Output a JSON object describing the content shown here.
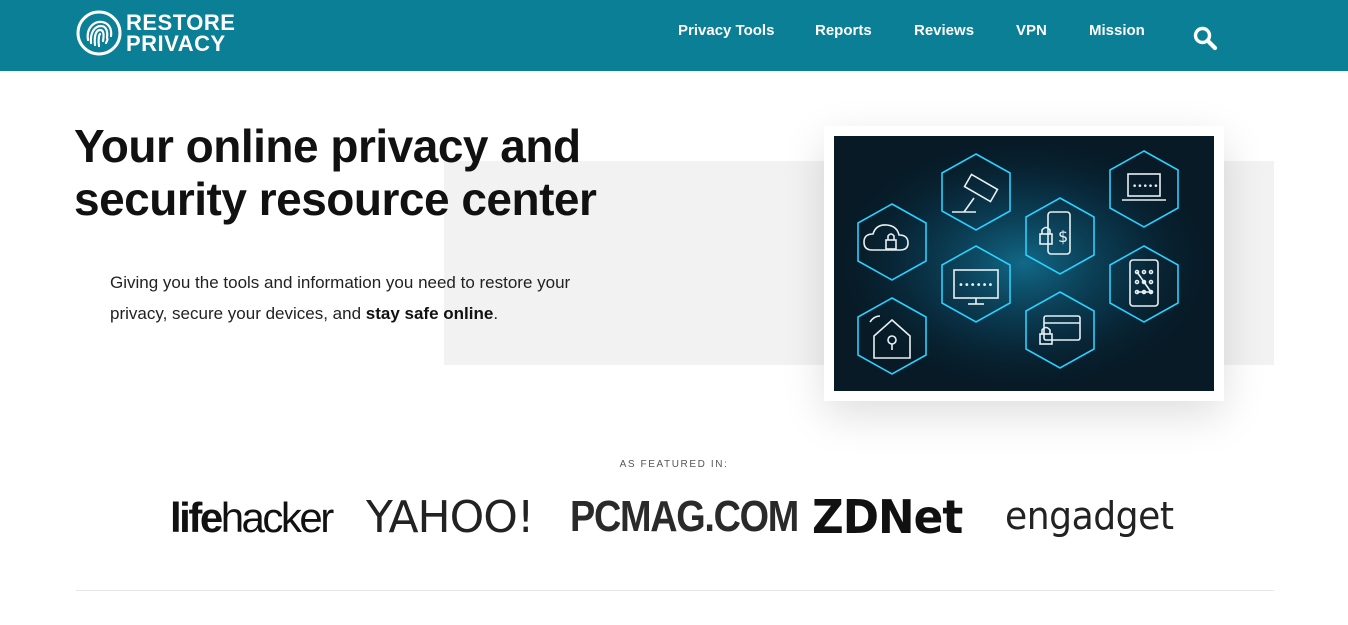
{
  "brand": {
    "line1": "RESTORE",
    "line2": "PRIVACY",
    "color": "#0a7f96",
    "logo_icon": "fingerprint-icon"
  },
  "nav": {
    "items": [
      {
        "label": "Privacy Tools"
      },
      {
        "label": "Reports"
      },
      {
        "label": "Reviews"
      },
      {
        "label": "VPN"
      },
      {
        "label": "Mission"
      }
    ],
    "search_icon": "search-icon"
  },
  "hero": {
    "title": "Your online privacy and security resource center",
    "subtitle_prefix": "Giving you the tools and information you need to restore your privacy, secure your devices, and ",
    "subtitle_bold": "stay safe online",
    "subtitle_suffix": ".",
    "illustration_icons": [
      "cloud-lock-icon",
      "security-camera-icon",
      "phone-payment-icon",
      "laptop-password-icon",
      "monitor-password-icon",
      "tablet-pattern-lock-icon",
      "smart-home-lock-icon",
      "credit-card-lock-icon"
    ]
  },
  "featured": {
    "label": "AS FEATURED IN:",
    "logos": {
      "lifehacker_a": "life",
      "lifehacker_b": "hacker",
      "yahoo": "YAHOO!",
      "pcmag": "PCMAG.COM",
      "zdnet": "ZDNet",
      "engadget": "engadget"
    }
  }
}
